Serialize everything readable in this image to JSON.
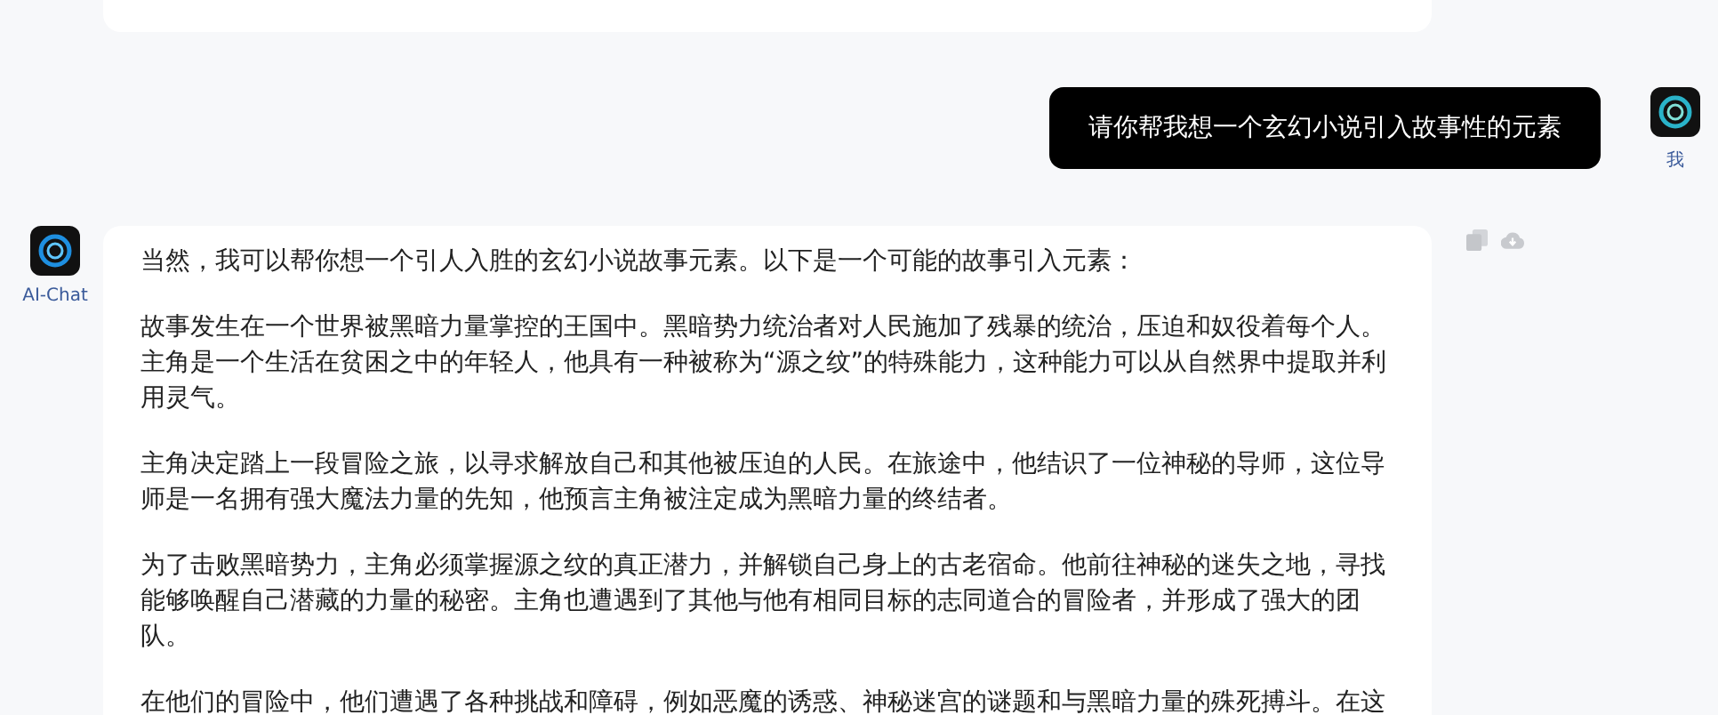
{
  "messages": [
    {
      "kind": "user",
      "author": "我",
      "text": "请你帮我想一个玄幻小说引入故事性的元素"
    },
    {
      "kind": "assistant",
      "author": "AI-Chat",
      "paragraphs": [
        "当然，我可以帮你想一个引人入胜的玄幻小说故事元素。以下是一个可能的故事引入元素：",
        "故事发生在一个世界被黑暗力量掌控的王国中。黑暗势力统治者对人民施加了残暴的统治，压迫和奴役着每个人。主角是一个生活在贫困之中的年轻人，他具有一种被称为“源之纹”的特殊能力，这种能力可以从自然界中提取并利用灵气。",
        "主角决定踏上一段冒险之旅，以寻求解放自己和其他被压迫的人民。在旅途中，他结识了一位神秘的导师，这位导师是一名拥有强大魔法力量的先知，他预言主角被注定成为黑暗力量的终结者。",
        "为了击败黑暗势力，主角必须掌握源之纹的真正潜力，并解锁自己身上的古老宿命。他前往神秘的迷失之地，寻找能够唤醒自己潜藏的力量的秘密。主角也遭遇到了其他与他有相同目标的志同道合的冒险者，并形成了强大的团队。",
        "在他们的冒险中，他们遭遇了各种挑战和障碍，例如恶魔的诱惑、神秘迷宫的谜题和与黑暗力量的殊死搏斗。在这"
      ]
    }
  ]
}
